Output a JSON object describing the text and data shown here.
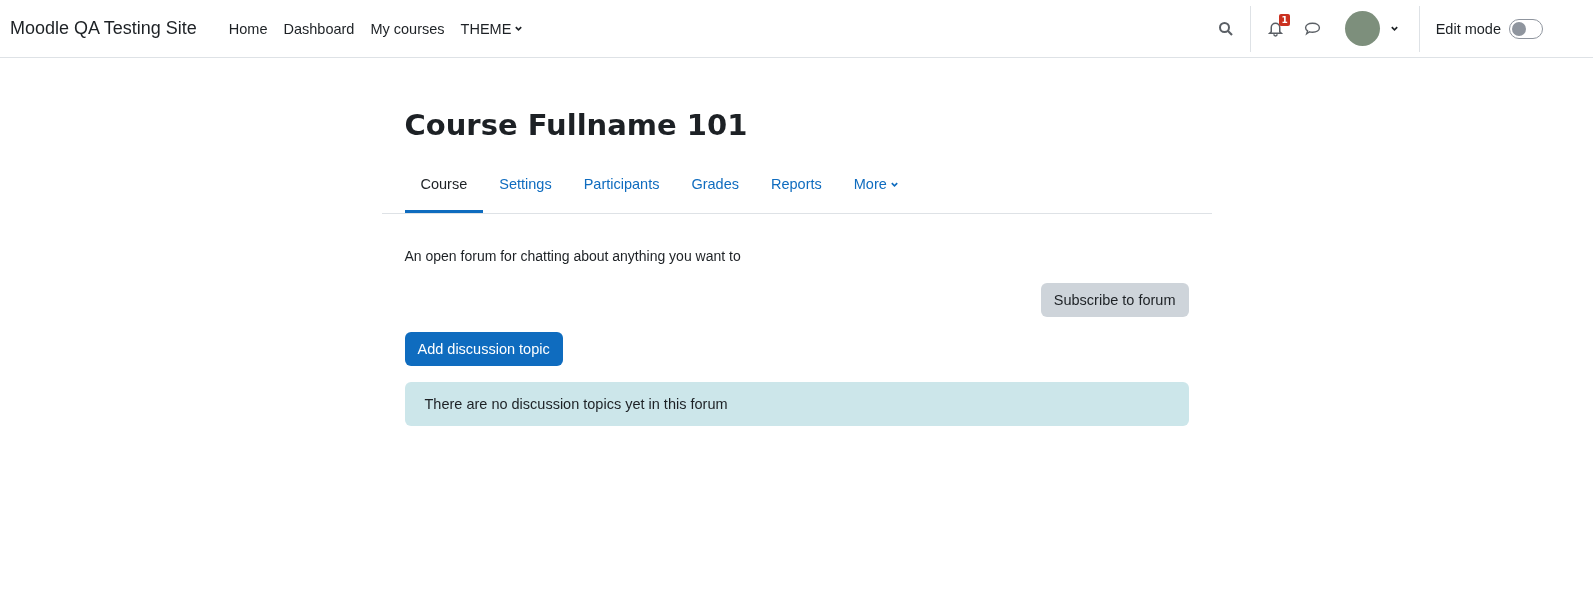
{
  "navbar": {
    "site_name": "Moodle QA Testing Site",
    "links": [
      {
        "label": "Home",
        "kind": "link"
      },
      {
        "label": "Dashboard",
        "kind": "link"
      },
      {
        "label": "My courses",
        "kind": "link"
      },
      {
        "label": "THEME",
        "kind": "dropdown"
      }
    ],
    "notification_count": "1",
    "edit_mode": {
      "label": "Edit mode",
      "on": false
    }
  },
  "course": {
    "title": "Course Fullname 101",
    "tabs": [
      {
        "label": "Course",
        "selected": true,
        "kind": "tab"
      },
      {
        "label": "Settings",
        "selected": false,
        "kind": "tab"
      },
      {
        "label": "Participants",
        "selected": false,
        "kind": "tab"
      },
      {
        "label": "Grades",
        "selected": false,
        "kind": "tab"
      },
      {
        "label": "Reports",
        "selected": false,
        "kind": "tab"
      },
      {
        "label": "More",
        "selected": false,
        "kind": "dropdown"
      }
    ]
  },
  "forum": {
    "intro": "An open forum for chatting about anything you want to",
    "subscribe_button": "Subscribe to forum",
    "add_button": "Add discussion topic",
    "notice": "There are no discussion topics yet in this forum"
  }
}
